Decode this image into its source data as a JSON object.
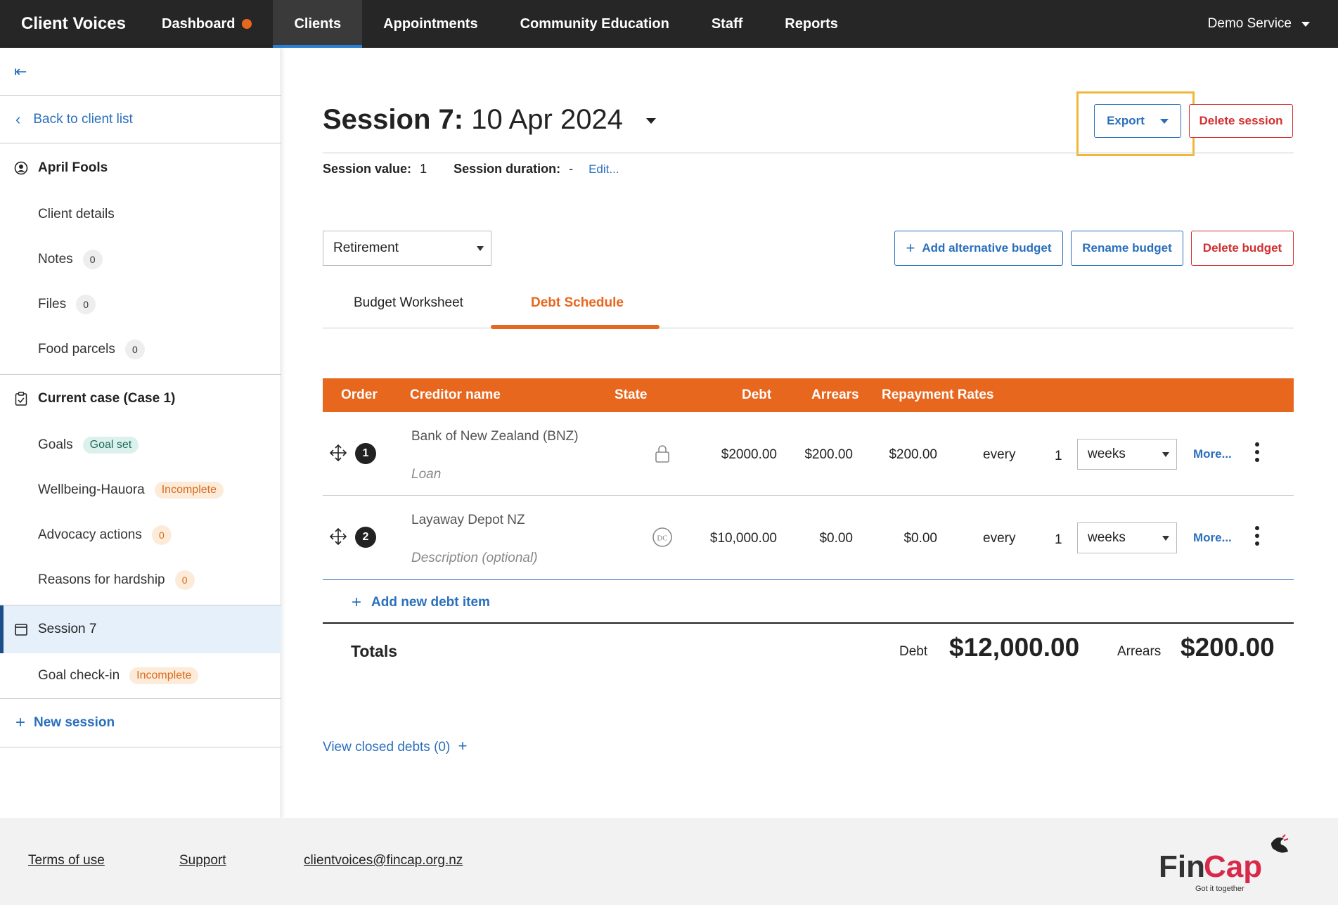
{
  "nav": {
    "brand": "Client Voices",
    "items": [
      "Dashboard",
      "Clients",
      "Appointments",
      "Community Education",
      "Staff",
      "Reports"
    ],
    "service": "Demo Service"
  },
  "sidebar": {
    "back": "Back to client list",
    "client_name": "April Fools",
    "client_items": [
      {
        "label": "Client details"
      },
      {
        "label": "Notes",
        "count": "0"
      },
      {
        "label": "Files",
        "count": "0"
      },
      {
        "label": "Food parcels",
        "count": "0"
      }
    ],
    "case_title": "Current case (Case 1)",
    "case_items": [
      {
        "label": "Goals",
        "badge": "Goal set"
      },
      {
        "label": "Wellbeing-Hauora",
        "badge": "Incomplete"
      },
      {
        "label": "Advocacy actions",
        "count": "0"
      },
      {
        "label": "Reasons for hardship",
        "count": "0"
      }
    ],
    "session_title": "Session 7",
    "session_items": [
      {
        "label": "Goal check-in",
        "badge": "Incomplete"
      }
    ],
    "new_session": "New session"
  },
  "session": {
    "title_prefix": "Session 7:",
    "title_date": "10 Apr 2024",
    "export_label": "Export",
    "delete_label": "Delete session",
    "value_label": "Session value:",
    "value": "1",
    "duration_label": "Session duration:",
    "duration": "-",
    "edit_label": "Edit..."
  },
  "budget": {
    "selected": "Retirement",
    "add_alt": "Add alternative budget",
    "rename": "Rename budget",
    "delete": "Delete budget"
  },
  "tabs": [
    "Budget Worksheet",
    "Debt Schedule"
  ],
  "table": {
    "headers": [
      "Order",
      "Creditor name",
      "State",
      "Debt",
      "Arrears",
      "Repayment Rates"
    ],
    "rows": [
      {
        "order": "1",
        "creditor": "Bank of New Zealand (BNZ)",
        "desc": "Loan",
        "state_icon": "lock-icon",
        "debt": "$2000.00",
        "arrears": "$200.00",
        "rate": "$200.00",
        "every": "every",
        "freq": "1",
        "period": "weeks",
        "more": "More..."
      },
      {
        "order": "2",
        "creditor": "Layaway Depot NZ",
        "desc": "Description (optional)",
        "state_icon": "dc-icon",
        "debt": "$10,000.00",
        "arrears": "$0.00",
        "rate": "$0.00",
        "every": "every",
        "freq": "1",
        "period": "weeks",
        "more": "More..."
      }
    ],
    "add_label": "Add new debt item",
    "totals_label": "Totals",
    "debt_label": "Debt",
    "debt_total": "$12,000.00",
    "arrears_label": "Arrears",
    "arrears_total": "$200.00",
    "view_closed": "View closed debts (0)"
  },
  "footer": {
    "terms": "Terms of use",
    "support": "Support",
    "email": "clientvoices@fincap.org.nz",
    "logo_text": "FinCap",
    "logo_tagline": "Got it together"
  },
  "colors": {
    "accent": "#e8671e",
    "link": "#2a6fbd",
    "danger": "#d32f2f",
    "nav_bg": "#262626"
  }
}
